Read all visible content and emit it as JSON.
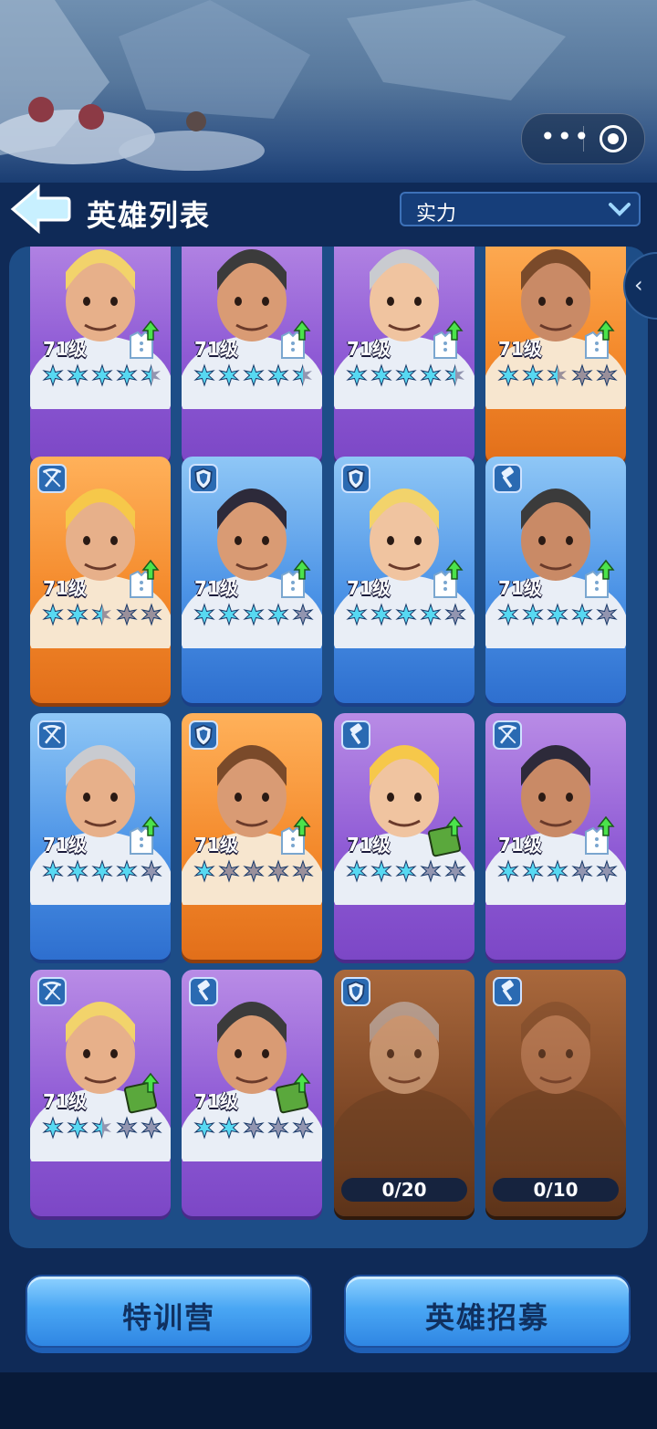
{
  "header": {
    "title": "英雄列表",
    "sort_label": "实力"
  },
  "capsule": {
    "more_icon": "more-icon",
    "close_icon": "target-icon"
  },
  "colors": {
    "purple": "#8f5bd5",
    "orange": "#f48a2c",
    "blue": "#4c93e6",
    "locked": "#7c4625",
    "star_on": "#57d9f2"
  },
  "heroes": [
    {
      "level": "71级",
      "rarity": "purple",
      "role": "none",
      "stars": 4.5,
      "upgrade": "coat"
    },
    {
      "level": "71级",
      "rarity": "purple",
      "role": "none",
      "stars": 4.5,
      "upgrade": "coat"
    },
    {
      "level": "71级",
      "rarity": "purple",
      "role": "none",
      "stars": 4.5,
      "upgrade": "coat"
    },
    {
      "level": "71级",
      "rarity": "orange",
      "role": "none",
      "stars": 2.5,
      "upgrade": "coat"
    },
    {
      "level": "71级",
      "rarity": "orange",
      "role": "crossbow",
      "stars": 2.5,
      "upgrade": "coat"
    },
    {
      "level": "71级",
      "rarity": "blue",
      "role": "shield",
      "stars": 4,
      "upgrade": "coat"
    },
    {
      "level": "71级",
      "rarity": "blue",
      "role": "shield",
      "stars": 4,
      "upgrade": "coat"
    },
    {
      "level": "71级",
      "rarity": "blue",
      "role": "hammer",
      "stars": 4,
      "upgrade": "coat"
    },
    {
      "level": "71级",
      "rarity": "blue",
      "role": "crossbow",
      "stars": 4,
      "upgrade": "coat"
    },
    {
      "level": "71级",
      "rarity": "orange",
      "role": "shield",
      "stars": 1,
      "upgrade": "coat"
    },
    {
      "level": "71级",
      "rarity": "purple",
      "role": "hammer",
      "stars": 3,
      "upgrade": "book"
    },
    {
      "level": "71级",
      "rarity": "purple",
      "role": "crossbow",
      "stars": 3,
      "upgrade": "coat"
    },
    {
      "level": "71级",
      "rarity": "purple",
      "role": "crossbow",
      "stars": 2.5,
      "upgrade": "book"
    },
    {
      "level": "71级",
      "rarity": "purple",
      "role": "hammer",
      "stars": 2,
      "upgrade": "book"
    },
    {
      "rarity": "locked",
      "role": "shield",
      "progress": "0/20"
    },
    {
      "rarity": "locked",
      "role": "hammer",
      "progress": "0/10"
    }
  ],
  "buttons": {
    "training": "特训营",
    "recruit": "英雄招募"
  }
}
